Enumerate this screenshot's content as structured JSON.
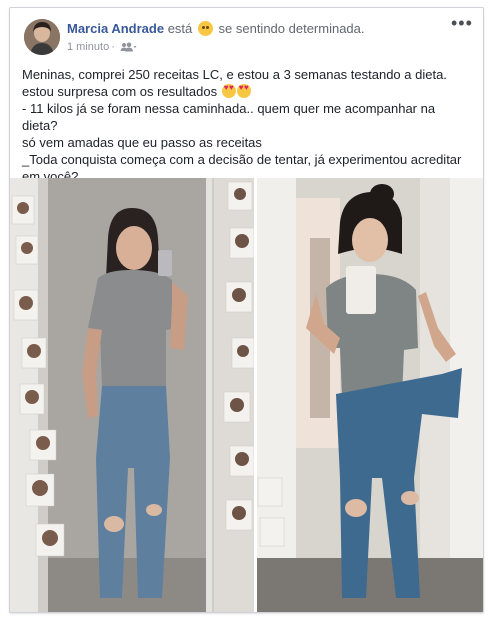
{
  "post": {
    "author": "Marcia Andrade",
    "verb": "está",
    "feeling": "se sentindo determinada.",
    "time": "1 minuto",
    "audience_icon": "friends-icon",
    "more_label": "•••",
    "text_lines": [
      "Meninas, comprei 250 receitas LC, e estou a 3 semanas testando a dieta.",
      "estou surpresa com os resultados",
      "- 11 kilos já se foram nessa caminhada.. quem quer me acompanhar na dieta?",
      "só vem amadas que eu passo as receitas",
      "_Toda conquista começa com a decisão de tentar, já experimentou acreditar",
      "em você?"
    ]
  },
  "colors": {
    "author": "#385898",
    "meta": "#90949c",
    "text": "#1d2129",
    "border": "#cfd2d8"
  }
}
